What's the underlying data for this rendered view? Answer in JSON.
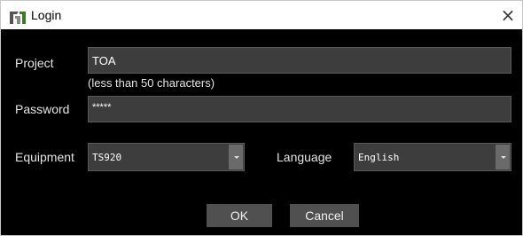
{
  "window": {
    "title": "Login",
    "close_glyph": "×",
    "icon": "app-logo-icon"
  },
  "form": {
    "project": {
      "label": "Project",
      "value": "TOA",
      "hint": "(less than 50 characters)"
    },
    "password": {
      "label": "Password",
      "value": "*****"
    },
    "equipment": {
      "label": "Equipment",
      "value": "TS920"
    },
    "language": {
      "label": "Language",
      "value": "English"
    }
  },
  "buttons": {
    "ok": "OK",
    "cancel": "Cancel"
  },
  "colors": {
    "dialog_bg": "#000000",
    "field_bg": "#3d3d3d",
    "button_bg": "#505050",
    "text": "#e6e6e6"
  }
}
